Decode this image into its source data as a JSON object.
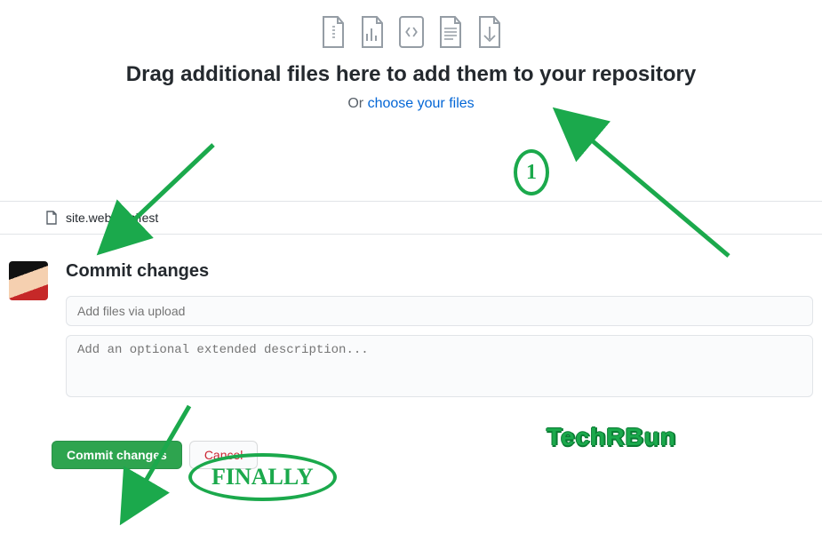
{
  "dropzone": {
    "heading": "Drag additional files here to add them to your repository",
    "or_prefix": "Or ",
    "choose_link": "choose your files"
  },
  "file_list": {
    "items": [
      {
        "name": "site.webmanifest"
      }
    ]
  },
  "commit": {
    "section_title": "Commit changes",
    "summary_placeholder": "Add files via upload",
    "description_placeholder": "Add an optional extended description...",
    "commit_button": "Commit changes",
    "cancel_button": "Cancel"
  },
  "annotations": {
    "step_number": "1",
    "finally_label": "FINALLY",
    "watermark": "TechRBun"
  },
  "colors": {
    "primary_green": "#2ea44f",
    "link_blue": "#0366d6",
    "danger_red": "#cb2431",
    "annotation_green": "#1ba94c"
  }
}
